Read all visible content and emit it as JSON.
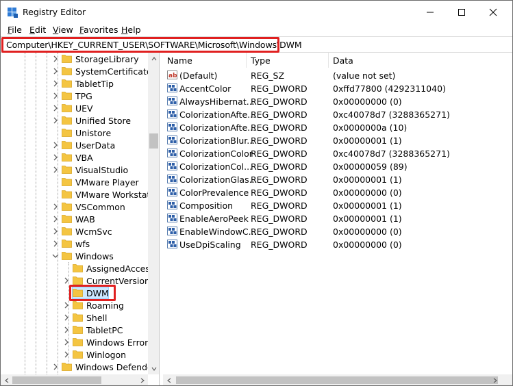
{
  "window": {
    "title": "Registry Editor",
    "icon": "registry-editor-icon"
  },
  "menu": [
    "File",
    "Edit",
    "View",
    "Favorites",
    "Help"
  ],
  "address": {
    "path": "Computer\\HKEY_CURRENT_USER\\SOFTWARE\\Microsoft\\Windows\\DWM",
    "highlight_color": "#e02020"
  },
  "tree": {
    "items": [
      {
        "label": "StorageLibrary",
        "level": 1,
        "expander": "collapsed"
      },
      {
        "label": "SystemCertificates",
        "level": 1,
        "expander": "collapsed"
      },
      {
        "label": "TabletTip",
        "level": 1,
        "expander": "collapsed"
      },
      {
        "label": "TPG",
        "level": 1,
        "expander": "collapsed"
      },
      {
        "label": "UEV",
        "level": 1,
        "expander": "collapsed"
      },
      {
        "label": "Unified Store",
        "level": 1,
        "expander": "collapsed"
      },
      {
        "label": "Unistore",
        "level": 1,
        "expander": "none"
      },
      {
        "label": "UserData",
        "level": 1,
        "expander": "collapsed"
      },
      {
        "label": "VBA",
        "level": 1,
        "expander": "collapsed"
      },
      {
        "label": "VisualStudio",
        "level": 1,
        "expander": "collapsed"
      },
      {
        "label": "VMware Player",
        "level": 1,
        "expander": "none"
      },
      {
        "label": "VMware Workstation",
        "level": 1,
        "expander": "none"
      },
      {
        "label": "VSCommon",
        "level": 1,
        "expander": "collapsed"
      },
      {
        "label": "WAB",
        "level": 1,
        "expander": "collapsed"
      },
      {
        "label": "WcmSvc",
        "level": 1,
        "expander": "collapsed"
      },
      {
        "label": "wfs",
        "level": 1,
        "expander": "collapsed"
      },
      {
        "label": "Windows",
        "level": 1,
        "expander": "expanded"
      },
      {
        "label": "AssignedAccessC",
        "level": 2,
        "expander": "none"
      },
      {
        "label": "CurrentVersion",
        "level": 2,
        "expander": "collapsed"
      },
      {
        "label": "DWM",
        "level": 2,
        "expander": "none",
        "selected": true
      },
      {
        "label": "Roaming",
        "level": 2,
        "expander": "collapsed"
      },
      {
        "label": "Shell",
        "level": 2,
        "expander": "collapsed"
      },
      {
        "label": "TabletPC",
        "level": 2,
        "expander": "collapsed"
      },
      {
        "label": "Windows Error Re",
        "level": 2,
        "expander": "collapsed"
      },
      {
        "label": "Winlogon",
        "level": 2,
        "expander": "collapsed"
      },
      {
        "label": "Windows Defender S",
        "level": 1,
        "expander": "collapsed"
      }
    ]
  },
  "list": {
    "columns": [
      "Name",
      "Type",
      "Data"
    ],
    "rows": [
      {
        "name": "(Default)",
        "type": "REG_SZ",
        "data": "(value not set)",
        "icon": "string-value-icon"
      },
      {
        "name": "AccentColor",
        "type": "REG_DWORD",
        "data": "0xffd77800 (4292311040)",
        "icon": "binary-value-icon"
      },
      {
        "name": "AlwaysHibernat...",
        "type": "REG_DWORD",
        "data": "0x00000000 (0)",
        "icon": "binary-value-icon"
      },
      {
        "name": "ColorizationAfte...",
        "type": "REG_DWORD",
        "data": "0xc40078d7 (3288365271)",
        "icon": "binary-value-icon"
      },
      {
        "name": "ColorizationAfte...",
        "type": "REG_DWORD",
        "data": "0x0000000a (10)",
        "icon": "binary-value-icon"
      },
      {
        "name": "ColorizationBlur...",
        "type": "REG_DWORD",
        "data": "0x00000001 (1)",
        "icon": "binary-value-icon"
      },
      {
        "name": "ColorizationColor",
        "type": "REG_DWORD",
        "data": "0xc40078d7 (3288365271)",
        "icon": "binary-value-icon"
      },
      {
        "name": "ColorizationCol...",
        "type": "REG_DWORD",
        "data": "0x00000059 (89)",
        "icon": "binary-value-icon"
      },
      {
        "name": "ColorizationGlas...",
        "type": "REG_DWORD",
        "data": "0x00000001 (1)",
        "icon": "binary-value-icon"
      },
      {
        "name": "ColorPrevalence",
        "type": "REG_DWORD",
        "data": "0x00000000 (0)",
        "icon": "binary-value-icon"
      },
      {
        "name": "Composition",
        "type": "REG_DWORD",
        "data": "0x00000001 (1)",
        "icon": "binary-value-icon"
      },
      {
        "name": "EnableAeroPeek",
        "type": "REG_DWORD",
        "data": "0x00000001 (1)",
        "icon": "binary-value-icon"
      },
      {
        "name": "EnableWindowC...",
        "type": "REG_DWORD",
        "data": "0x00000000 (0)",
        "icon": "binary-value-icon"
      },
      {
        "name": "UseDpiScaling",
        "type": "REG_DWORD",
        "data": "0x00000000 (0)",
        "icon": "binary-value-icon"
      }
    ]
  },
  "colors": {
    "folder": "#f4c542",
    "selection": "#cce8ff",
    "highlight": "#e02020"
  }
}
